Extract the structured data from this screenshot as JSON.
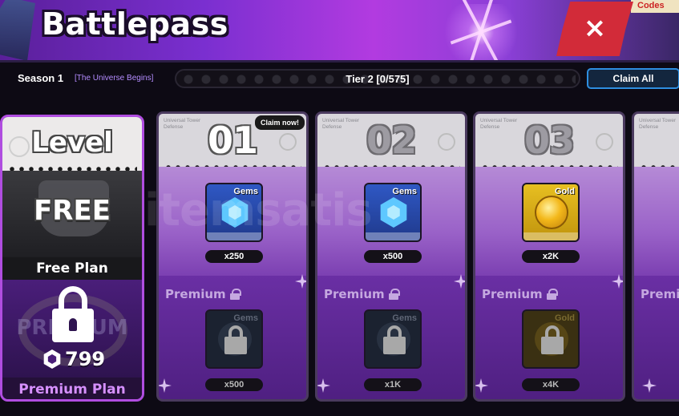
{
  "header": {
    "title": "Battlepass",
    "codes_tab": "Codes",
    "close_label": "×"
  },
  "season": {
    "label": "Season 1",
    "subtitle": "[The Universe Begins]",
    "tier_text": "Tier 2 [0/575]",
    "tier_progress": 0,
    "claim_all_label": "Claim All"
  },
  "left_panel": {
    "level_label": "Level",
    "free_badge": "FREE",
    "free_plan_label": "Free Plan",
    "premium_bg_text": "PREMIUM",
    "price": "799",
    "premium_plan_label": "Premium Plan"
  },
  "cards": [
    {
      "number": "01",
      "brand": "Universal Tower Defense",
      "claim_badge": "Claim now!",
      "state": "claimable",
      "free_reward": {
        "type": "Gems",
        "amount": "x250",
        "icon": "gem-icon"
      },
      "premium_label": "Premium",
      "premium_reward": {
        "type": "Gems",
        "amount": "x500",
        "icon": "gem-icon"
      }
    },
    {
      "number": "02",
      "brand": "Universal Tower Defense",
      "claim_badge": "",
      "state": "locked",
      "free_reward": {
        "type": "Gems",
        "amount": "x500",
        "icon": "gem-icon"
      },
      "premium_label": "Premium",
      "premium_reward": {
        "type": "Gems",
        "amount": "x1K",
        "icon": "gem-icon"
      }
    },
    {
      "number": "03",
      "brand": "Universal Tower Defense",
      "claim_badge": "",
      "state": "locked",
      "free_reward": {
        "type": "Gold",
        "amount": "x2K",
        "icon": "gold-coin-icon"
      },
      "premium_label": "Premium",
      "premium_reward": {
        "type": "Gold",
        "amount": "x4K",
        "icon": "gold-coin-icon"
      }
    },
    {
      "number": "",
      "brand": "Universal Tower Defense",
      "claim_badge": "",
      "state": "partial",
      "free_reward": {
        "type": "",
        "amount": "",
        "icon": ""
      },
      "premium_label": "Premiu",
      "premium_reward": {
        "type": "",
        "amount": "",
        "icon": ""
      }
    }
  ],
  "watermark": "itemsatis",
  "colors": {
    "accent_purple": "#b04de0",
    "close_red": "#d22b39",
    "claim_all_border": "#2e8ee0",
    "gems_blue": "#2f58c4",
    "gold_yellow": "#e7bf21"
  }
}
